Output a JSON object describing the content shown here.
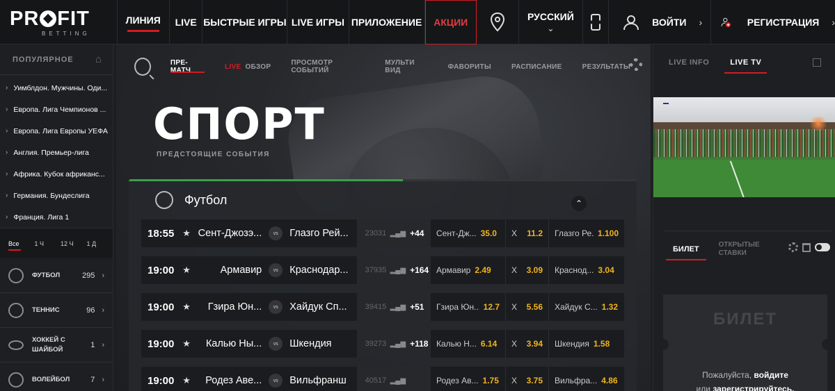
{
  "logo": {
    "name": "PROFIT",
    "sub": "BETTING"
  },
  "topnav": {
    "items": [
      "ЛИНИЯ",
      "LIVE",
      "БЫСТРЫЕ ИГРЫ",
      "LIVE ИГРЫ",
      "ПРИЛОЖЕНИЕ",
      "АКЦИИ"
    ],
    "language": "РУССКИЙ",
    "login": "ВОЙТИ",
    "register": "РЕГИСТРАЦИЯ"
  },
  "sidebar": {
    "popular_title": "ПОПУЛЯРНОЕ",
    "popular": [
      "Уимблдон. Мужчины. Оди...",
      "Европа. Лига Чемпионов ...",
      "Европа. Лига Европы УЕФА",
      "Англия. Премьер-лига",
      "Африка. Кубок африканс...",
      "Германия. Бундеслига",
      "Франция. Лига 1"
    ],
    "periods": [
      "Все",
      "1 Ч",
      "12 Ч",
      "1 Д"
    ],
    "sports": [
      {
        "name": "ФУТБОЛ",
        "count": "295"
      },
      {
        "name": "ТЕННИС",
        "count": "96"
      },
      {
        "name": "ХОККЕЙ С ШАЙБОЙ",
        "count": "1"
      },
      {
        "name": "ВОЛЕЙБОЛ",
        "count": "7"
      }
    ]
  },
  "subnav": {
    "items": [
      "ПРЕ-МАТЧ",
      "ОБЗОР",
      "ПРОСМОТР СОБЫТИЙ",
      "МУЛЬТИ ВИД",
      "ФАВОРИТЫ",
      "РАСПИСАНИЕ",
      "РЕЗУЛЬТАТЫ"
    ],
    "live_tag": "LIVE"
  },
  "hero": {
    "title": "СПОРТ",
    "subtitle": "ПРЕДСТОЯЩИЕ СОБЫТИЯ"
  },
  "panel": {
    "title": "Футбол",
    "vs": "vs",
    "draw_label": "X",
    "matches": [
      {
        "time": "18:55",
        "home": "Сент-Джозэ...",
        "away": "Глазго Рей...",
        "id": "23031",
        "more": "+44",
        "o1n": "Сент-Дж...",
        "o1": "35.0",
        "ox": "11.2",
        "o2n": "Глазго Ре...",
        "o2": "1.100"
      },
      {
        "time": "19:00",
        "home": "Армавир",
        "away": "Краснодар...",
        "id": "37935",
        "more": "+164",
        "o1n": "Армавир",
        "o1": "2.49",
        "ox": "3.09",
        "o2n": "Краснод...",
        "o2": "3.04"
      },
      {
        "time": "19:00",
        "home": "Гзира Юн...",
        "away": "Хайдук Сп...",
        "id": "39415",
        "more": "+51",
        "o1n": "Гзира Юн...",
        "o1": "12.7",
        "ox": "5.56",
        "o2n": "Хайдук С...",
        "o2": "1.32"
      },
      {
        "time": "19:00",
        "home": "Калью Ны...",
        "away": "Шкендия",
        "id": "39273",
        "more": "+118",
        "o1n": "Калью Н...",
        "o1": "6.14",
        "ox": "3.94",
        "o2n": "Шкендия",
        "o2": "1.58"
      },
      {
        "time": "19:00",
        "home": "Родез Аве...",
        "away": "Вильфранш",
        "id": "40517",
        "more": "",
        "o1n": "Родез Ав...",
        "o1": "1.75",
        "ox": "3.75",
        "o2n": "Вильфра...",
        "o2": "4.86"
      }
    ]
  },
  "right": {
    "tabs": [
      "LIVE INFO",
      "LIVE TV"
    ],
    "ticket_tab": "БИЛЕТ",
    "open_bets": "ОТКРЫТЫЕ СТАВКИ",
    "ticket_title": "БИЛЕТ",
    "msg_pre": "Пожалуйста,",
    "msg_login": "войдите",
    "msg_or": "или",
    "msg_reg": "зарегистрируйтесь."
  }
}
